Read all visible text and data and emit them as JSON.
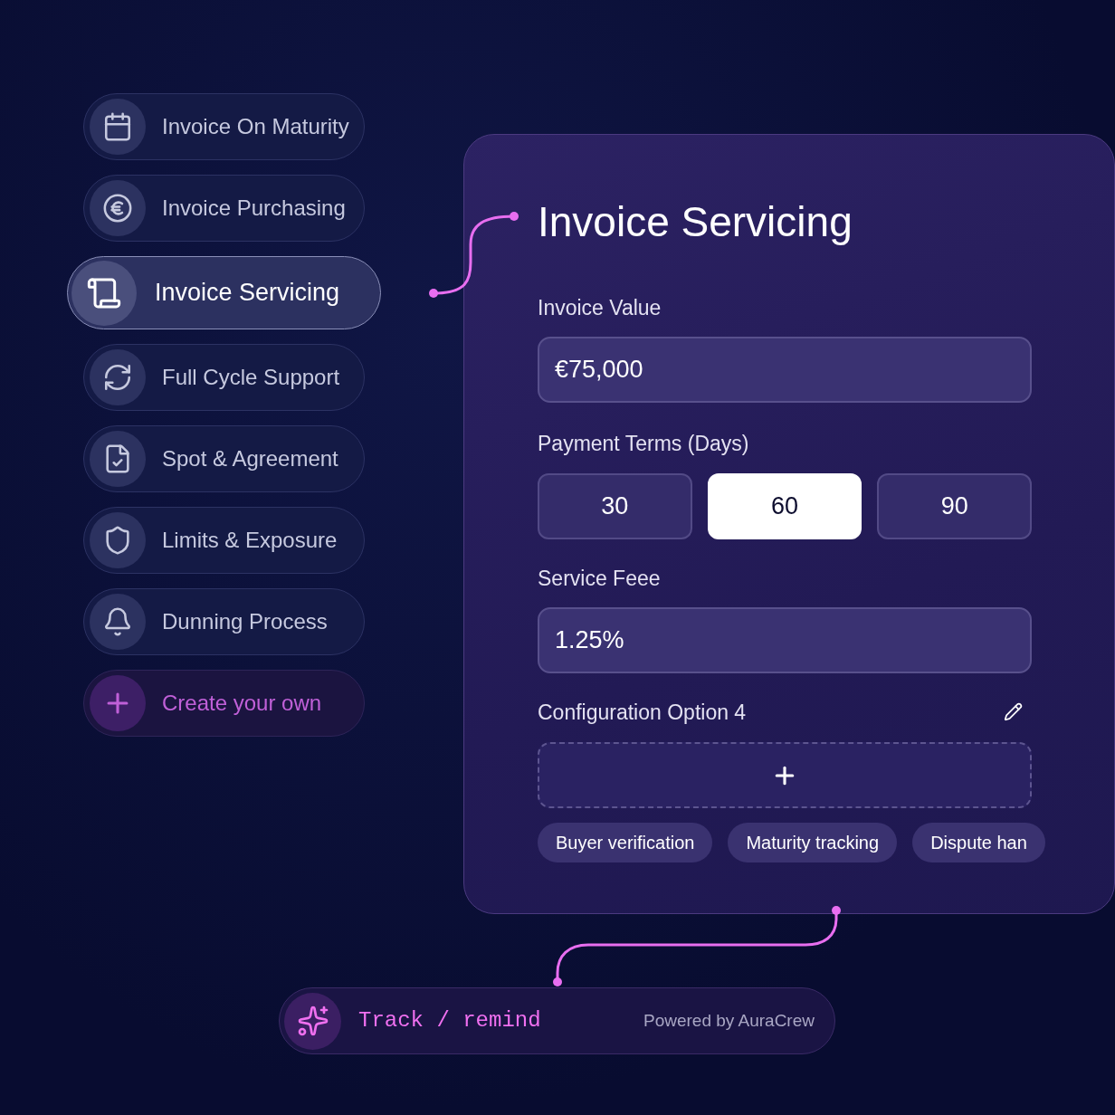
{
  "services": [
    {
      "kind": "service",
      "label": "Invoice On Maturity",
      "selected": false
    },
    {
      "kind": "service",
      "label": "Invoice Purchasing",
      "selected": false
    },
    {
      "kind": "service",
      "label": "Invoice Servicing",
      "selected": true
    },
    {
      "kind": "service",
      "label": "Full Cycle Support",
      "selected": false
    },
    {
      "kind": "service",
      "label": "Spot & Agreement",
      "selected": false
    },
    {
      "kind": "service",
      "label": "Limits & Exposure",
      "selected": false
    },
    {
      "kind": "service",
      "label": "Dunning Process",
      "selected": false
    },
    {
      "kind": "create",
      "label": "Create your own",
      "selected": false
    }
  ],
  "panel": {
    "title": "Invoice Servicing",
    "invoice_value": {
      "label": "Invoice Value",
      "value": "€75,000"
    },
    "payment_terms": {
      "label": "Payment Terms (Days)",
      "options": [
        {
          "label": "30",
          "selected": false
        },
        {
          "label": "60",
          "selected": true
        },
        {
          "label": "90",
          "selected": false
        }
      ]
    },
    "service_fee": {
      "label": "Service Feee",
      "value": "1.25%"
    },
    "config": {
      "label": "Configuration Option 4"
    },
    "chips": [
      "Buyer verification",
      "Maturity tracking",
      "Dispute han"
    ]
  },
  "footer": {
    "label": "Track / remind",
    "credit": "Powered by AuraCrew"
  }
}
